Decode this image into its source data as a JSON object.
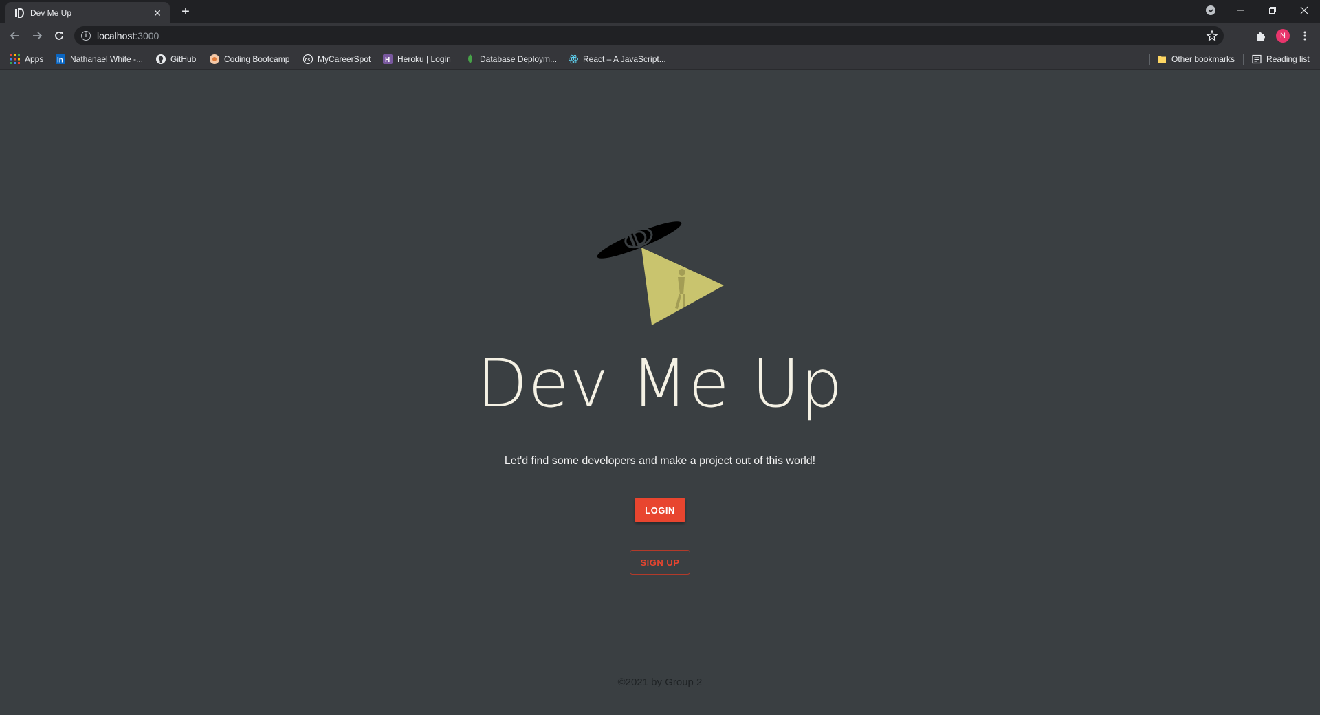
{
  "browser": {
    "tab": {
      "title": "Dev Me Up",
      "close": "✕"
    },
    "new_tab": "+",
    "address": {
      "host": "localhost",
      "port": ":3000"
    },
    "profile_initial": "N",
    "bookmarks": [
      {
        "label": "Apps",
        "icon": "apps-grid-icon"
      },
      {
        "label": "Nathanael White -...",
        "icon": "linkedin-icon"
      },
      {
        "label": "GitHub",
        "icon": "github-icon"
      },
      {
        "label": "Coding Bootcamp",
        "icon": "bootcamp-icon"
      },
      {
        "label": "MyCareerSpot",
        "icon": "careerspot-icon"
      },
      {
        "label": "Heroku | Login",
        "icon": "heroku-icon"
      },
      {
        "label": "Database Deploym...",
        "icon": "mongodb-leaf-icon"
      },
      {
        "label": "React – A JavaScript...",
        "icon": "react-icon"
      }
    ],
    "other_bookmarks": "Other bookmarks",
    "reading_list": "Reading list"
  },
  "page": {
    "title": "Dev Me Up",
    "tagline": "Let'd find some developers and make a project out of this world!",
    "login_label": "LOGIN",
    "signup_label": "SIGN UP",
    "footer": "©2021 by Group 2"
  },
  "colors": {
    "page_background": "#3a3f42",
    "accent": "#e8452f",
    "logo_beam": "#c9c46e",
    "title_text": "#f4f1e4"
  }
}
